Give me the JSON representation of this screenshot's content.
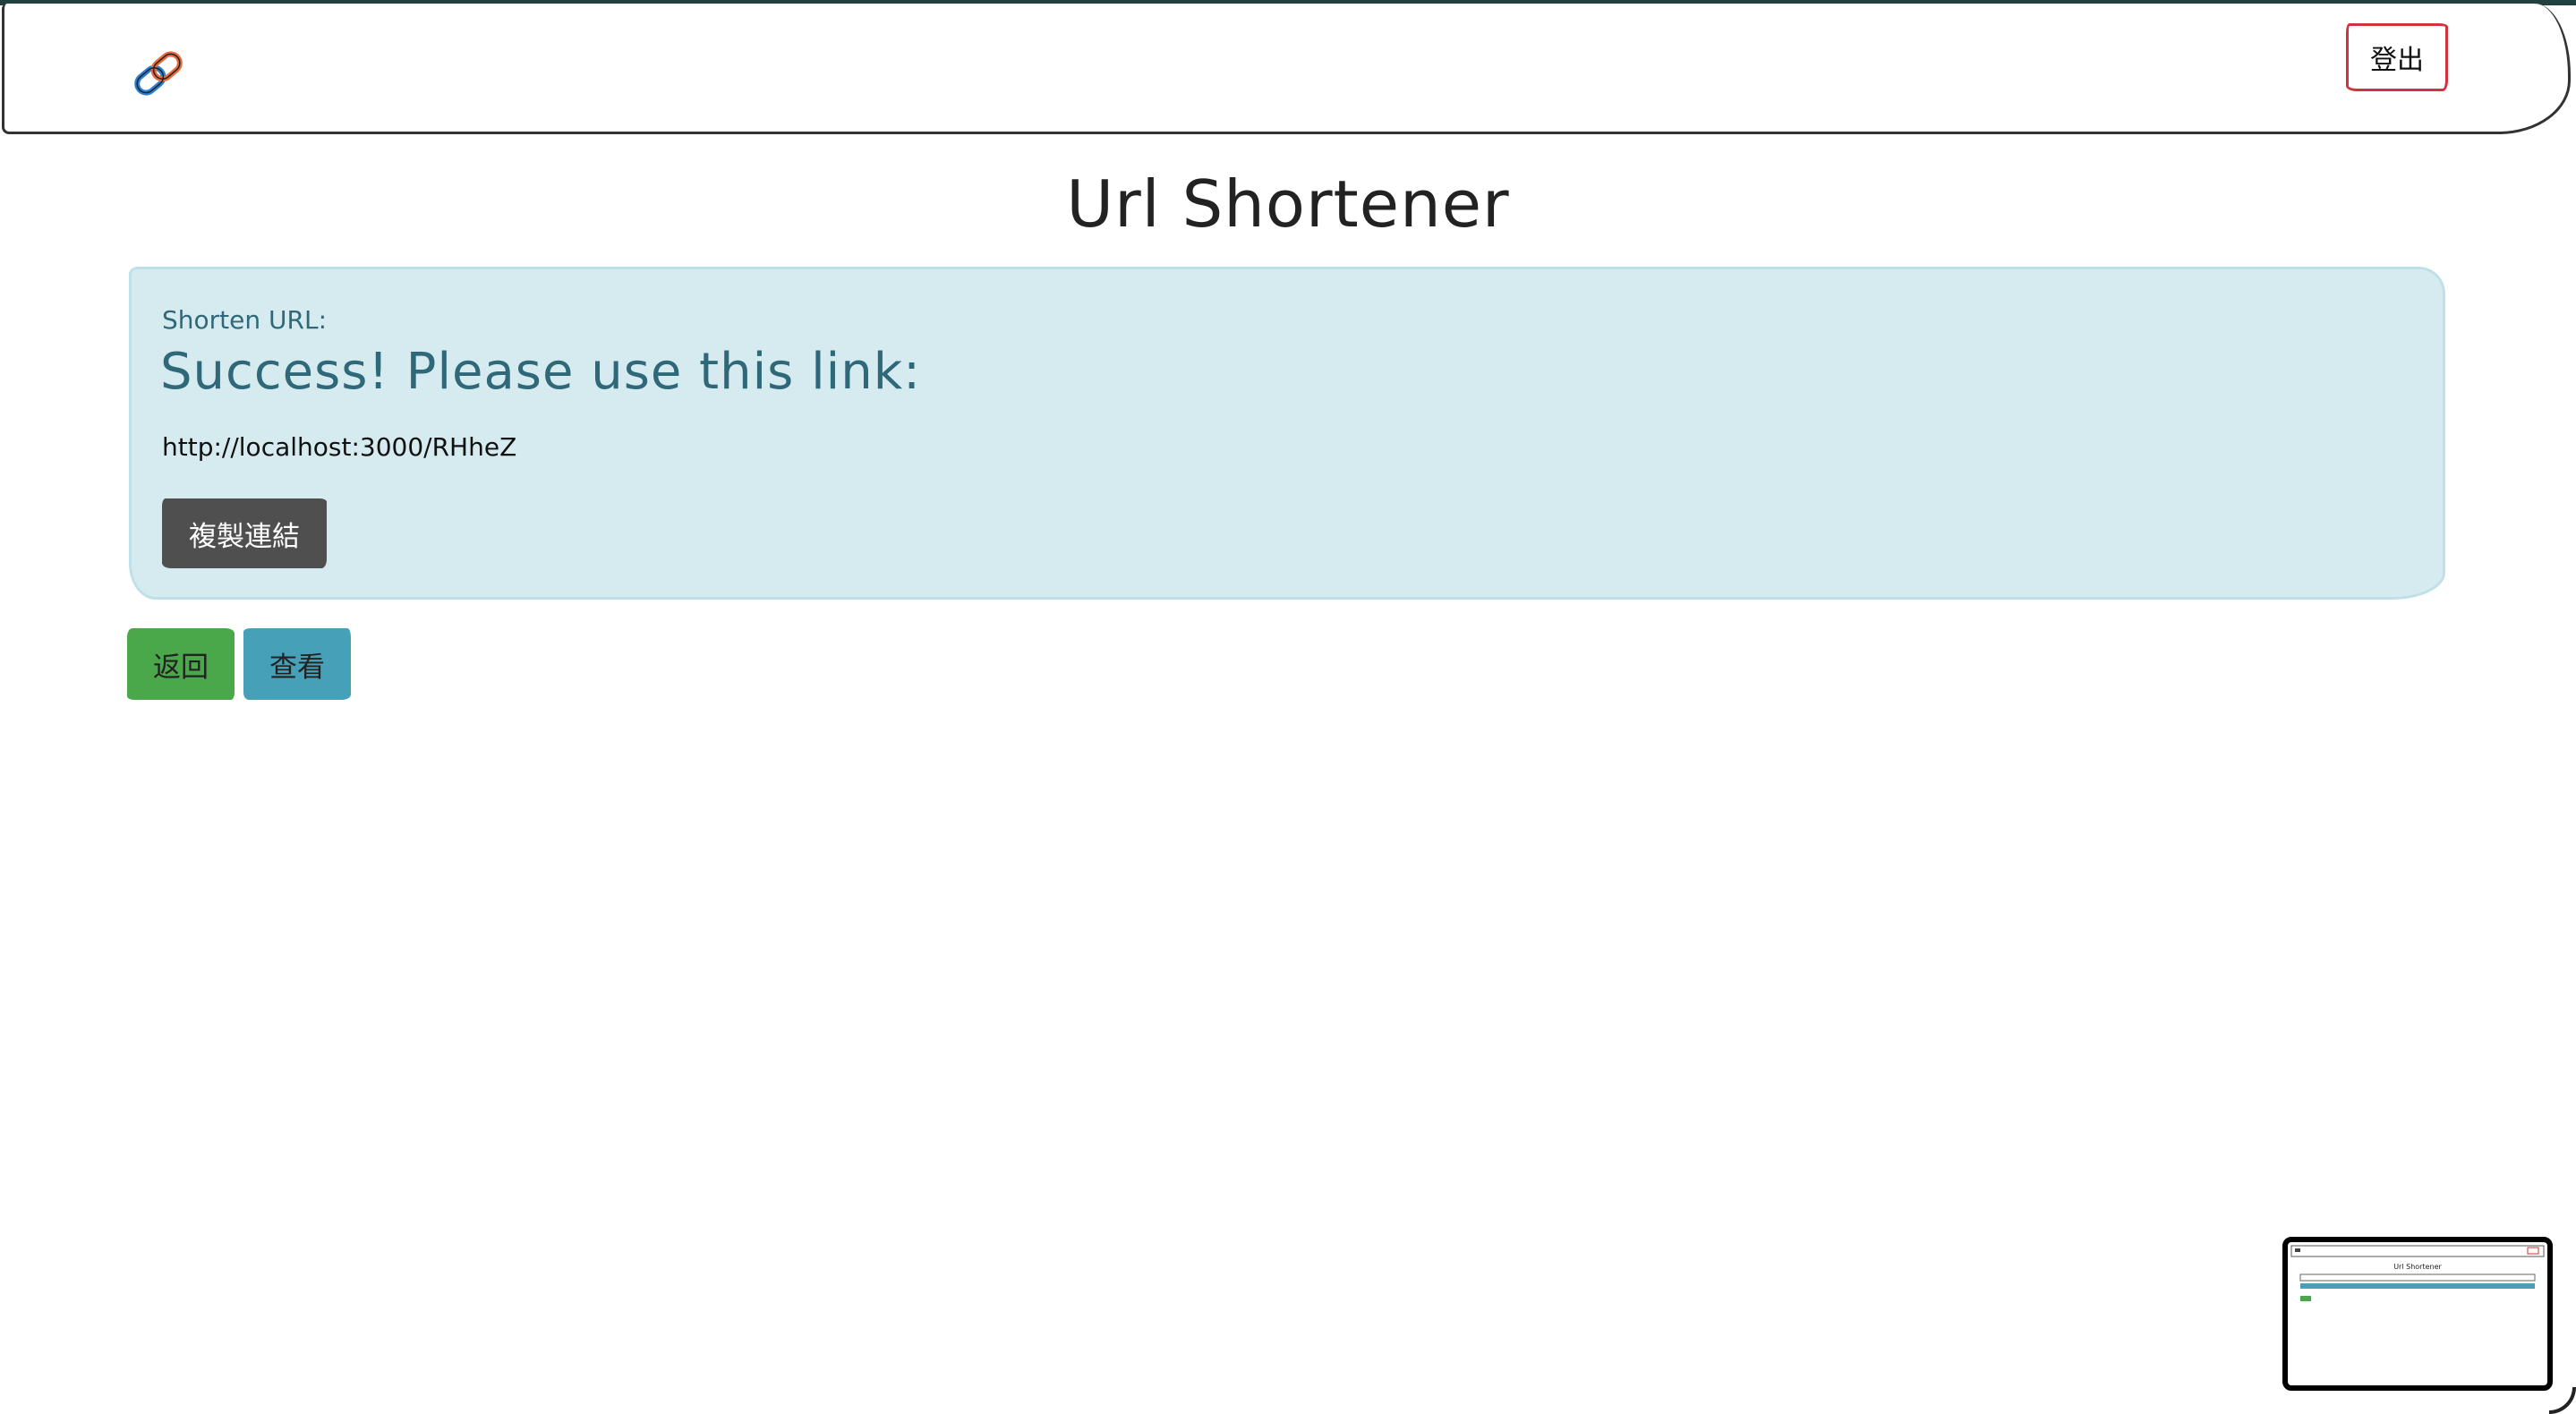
{
  "navbar": {
    "brand_icon": "link-icon",
    "logout_label": "登出"
  },
  "page": {
    "title": "Url Shortener"
  },
  "alert": {
    "label": "Shorten URL:",
    "heading": "Success! Please use this link:",
    "short_link": "http://localhost:3000/RHheZ",
    "copy_label": "複製連結"
  },
  "actions": {
    "back_label": "返回",
    "view_label": "查看"
  },
  "thumbnail": {
    "title": "Url Shortener"
  },
  "colors": {
    "alert_bg": "#d6ebf0",
    "alert_text": "#2f6878",
    "logout_border": "#d0323e",
    "back_bg": "#4aa74a",
    "view_bg": "#46a1b8",
    "copy_bg": "#4f4f4f"
  }
}
